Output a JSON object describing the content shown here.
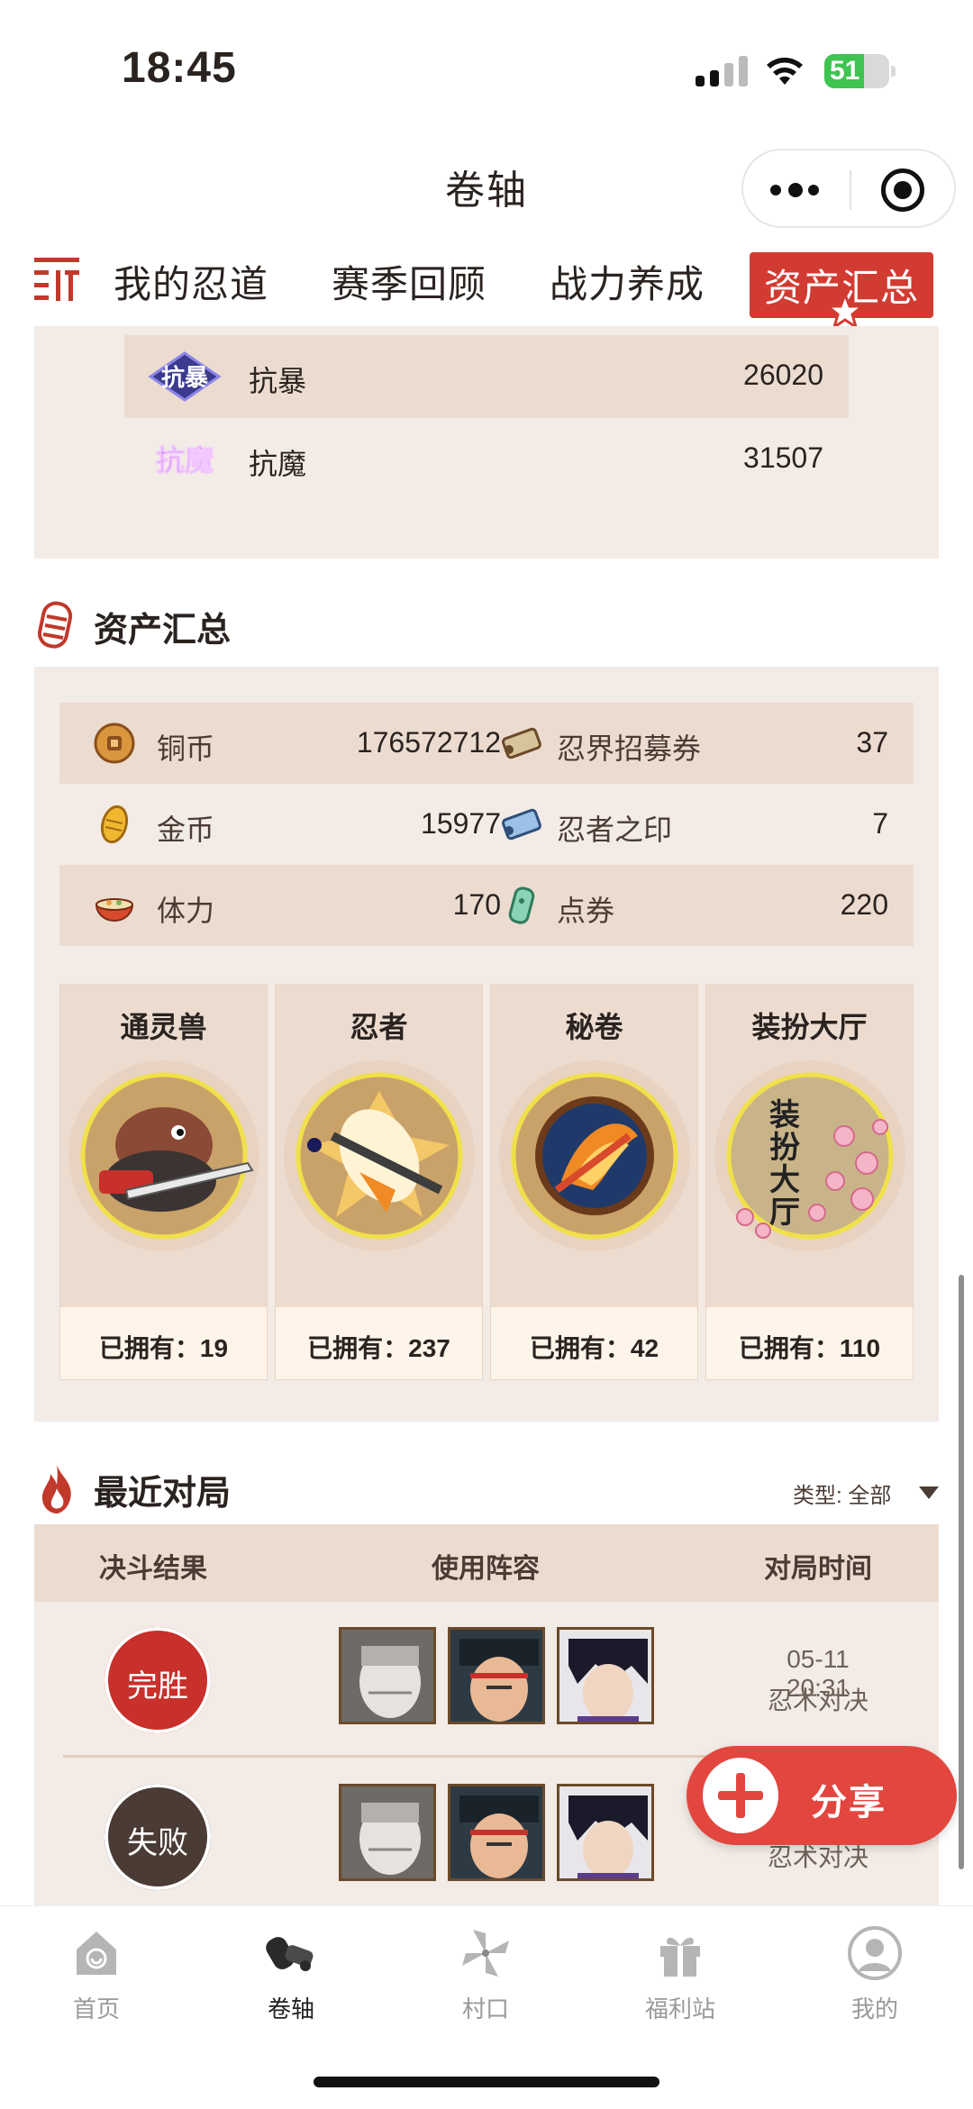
{
  "status_bar": {
    "time": "18:45",
    "battery": "51"
  },
  "nav": {
    "title": "卷轴"
  },
  "tabs": [
    {
      "label": "我的忍道",
      "active": false
    },
    {
      "label": "赛季回顾",
      "active": false
    },
    {
      "label": "战力养成",
      "active": false
    },
    {
      "label": "资产汇总",
      "active": true
    }
  ],
  "attributes": [
    {
      "icon": "抗暴",
      "label": "抗暴",
      "value": "26020"
    },
    {
      "icon": "抗魔",
      "label": "抗魔",
      "value": "31507"
    }
  ],
  "assets": {
    "title": "资产汇总",
    "rows": [
      {
        "left": {
          "icon": "copper-coin-icon",
          "label": "铜币",
          "value": "176572712"
        },
        "right": {
          "icon": "scroll-icon",
          "label": "忍界招募券",
          "value": "37"
        }
      },
      {
        "left": {
          "icon": "gold-coin-icon",
          "label": "金币",
          "value": "15977"
        },
        "right": {
          "icon": "ninja-seal-icon",
          "label": "忍者之印",
          "value": "7"
        }
      },
      {
        "left": {
          "icon": "ramen-icon",
          "label": "体力",
          "value": "170"
        },
        "right": {
          "icon": "voucher-icon",
          "label": "点券",
          "value": "220"
        }
      }
    ],
    "cards": [
      {
        "title": "通灵兽",
        "owned": "已拥有：19",
        "icon": "summon-beast-icon"
      },
      {
        "title": "忍者",
        "owned": "已拥有：237",
        "icon": "ninja-icon"
      },
      {
        "title": "秘卷",
        "owned": "已拥有：42",
        "icon": "secret-scroll-icon"
      },
      {
        "title": "装扮大厅",
        "owned": "已拥有：110",
        "icon": "costume-hall-icon",
        "emblem_text": "装扮大厅"
      }
    ]
  },
  "recent": {
    "title": "最近对局",
    "filter_label": "类型: 全部",
    "columns": [
      "决斗结果",
      "使用阵容",
      "对局时间"
    ],
    "matches": [
      {
        "result": "完胜",
        "type": "win",
        "time": "05-11 20:31",
        "mode": "忍术对决"
      },
      {
        "result": "失败",
        "type": "loss",
        "time": "",
        "mode": "忍术对决"
      }
    ]
  },
  "share": {
    "label": "分享"
  },
  "bottom_nav": [
    {
      "label": "首页",
      "icon": "home-icon",
      "active": false
    },
    {
      "label": "卷轴",
      "icon": "scroll-icon",
      "active": true
    },
    {
      "label": "村口",
      "icon": "pinwheel-icon",
      "active": false
    },
    {
      "label": "福利站",
      "icon": "gift-icon",
      "active": false
    },
    {
      "label": "我的",
      "icon": "profile-icon",
      "active": false
    }
  ],
  "colors": {
    "accent": "#d23b32",
    "panel": "#f3ebe6",
    "row_alt": "#ecdcd0",
    "loss": "#4b3b35"
  }
}
